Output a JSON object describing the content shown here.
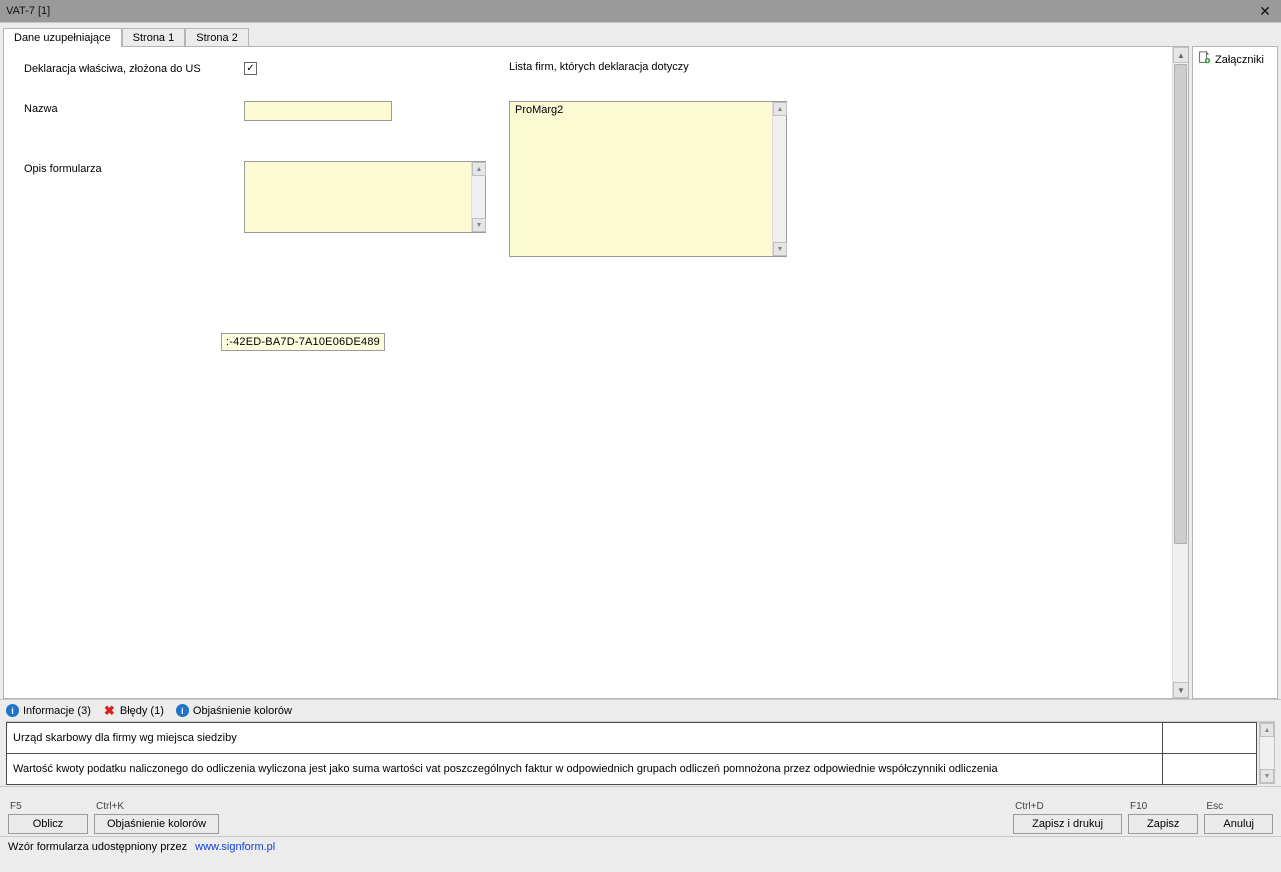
{
  "window": {
    "title": "VAT-7 [1]"
  },
  "tabs": {
    "t0": "Dane uzupełniające",
    "t1": "Strona 1",
    "t2": "Strona 2"
  },
  "sidebar": {
    "attachments": "Załączniki"
  },
  "form": {
    "decl_label": "Deklaracja właściwa, złożona do US",
    "name_label": "Nazwa",
    "desc_label": "Opis formularza",
    "firms_label": "Lista firm, których deklaracja dotyczy",
    "firms_items": {
      "i0": "ProMarg2"
    },
    "name_value": "",
    "desc_value": "",
    "guid_value": ":-42ED-BA7D-7A10E06DE489"
  },
  "info_tabs": {
    "info": "Informacje (3)",
    "errors": "Błędy (1)",
    "legend": "Objaśnienie kolorów"
  },
  "messages": {
    "m0": "Urząd skarbowy dla firmy wg miejsca siedziby",
    "m1": "Wartość kwoty podatku naliczonego do odliczenia wyliczona jest jako suma wartości vat poszczególnych faktur w odpowiednich grupach odliczeń pomnożona przez odpowiednie współczynniki odliczenia"
  },
  "toolbar": {
    "f5": "F5",
    "oblicz": "Oblicz",
    "ctrlk": "Ctrl+K",
    "legend": "Objaśnienie kolorów",
    "ctrld": "Ctrl+D",
    "save_print": "Zapisz i drukuj",
    "f10": "F10",
    "save": "Zapisz",
    "esc": "Esc",
    "cancel": "Anuluj"
  },
  "footer": {
    "prefix": "Wzór formularza udostępniony przez",
    "link": "www.signform.pl"
  }
}
